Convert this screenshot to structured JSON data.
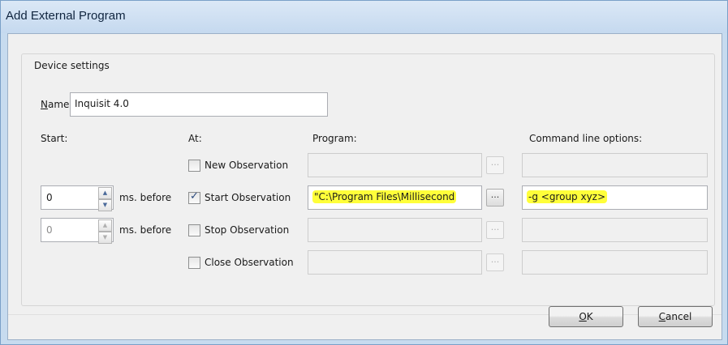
{
  "window": {
    "title": "Add External Program"
  },
  "group": {
    "label": "Device settings"
  },
  "name": {
    "label_first": "N",
    "label_rest": "ame:",
    "value": "Inquisit 4.0"
  },
  "headers": {
    "start": "Start:",
    "at": "At:",
    "program": "Program:",
    "options": "Command line options:"
  },
  "rows": [
    {
      "ms_value": "",
      "ms_label": "",
      "checked": false,
      "at_label": "New Observation",
      "program": "",
      "options": ""
    },
    {
      "ms_value": "0",
      "ms_label": "ms. before",
      "checked": true,
      "at_label": "Start Observation",
      "program": "\"C:\\Program Files\\Millisecond",
      "options": "-g <group xyz>"
    },
    {
      "ms_value": "0",
      "ms_label": "ms. before",
      "checked": false,
      "at_label": "Stop Observation",
      "program": "",
      "options": ""
    },
    {
      "ms_value": "",
      "ms_label": "",
      "checked": false,
      "at_label": "Close Observation",
      "program": "",
      "options": ""
    }
  ],
  "browse_label": "...",
  "spin": {
    "up": "▲",
    "down": "▼"
  },
  "check_mark": "✓",
  "ok": {
    "first": "O",
    "rest": "K"
  },
  "cancel": {
    "first": "C",
    "rest": "ancel"
  },
  "colors": {
    "highlight": "#ffff3a",
    "title_bar": "#c7dbef"
  }
}
